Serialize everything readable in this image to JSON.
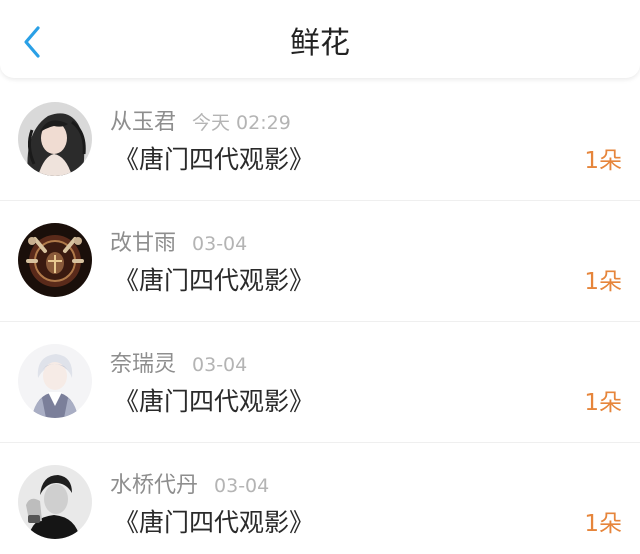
{
  "header": {
    "title": "鲜花",
    "back_icon": "chevron-left-icon",
    "accent_color": "#2aa0e6"
  },
  "rows": [
    {
      "name": "从玉君",
      "time": "今天 02:29",
      "work": "《唐门四代观影》",
      "count": "1朵",
      "avatar": "avatar-girl-icon"
    },
    {
      "name": "改甘雨",
      "time": "03-04",
      "work": "《唐门四代观影》",
      "count": "1朵",
      "avatar": "avatar-emblem-icon"
    },
    {
      "name": "奈瑞灵",
      "time": "03-04",
      "work": "《唐门四代观影》",
      "count": "1朵",
      "avatar": "avatar-anime-icon"
    },
    {
      "name": "水桥代丹",
      "time": "03-04",
      "work": "《唐门四代观影》",
      "count": "1朵",
      "avatar": "avatar-man-icon"
    }
  ],
  "colors": {
    "count": "#e6853b",
    "name": "#8e8e8e",
    "time": "#b4b4b4"
  }
}
